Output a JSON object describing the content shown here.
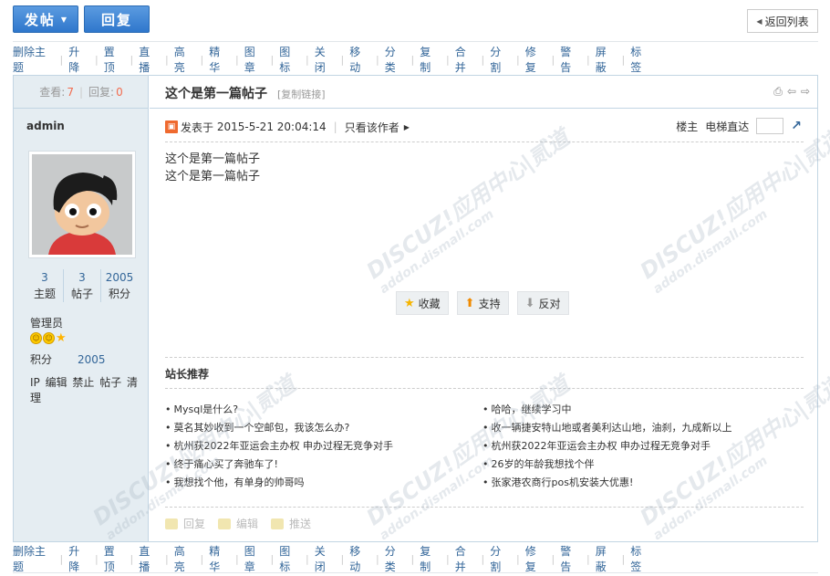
{
  "toolbar": {
    "post_label": "发帖",
    "reply_label": "回复",
    "back_label": "返回列表"
  },
  "mod_links": [
    "删除主题",
    "升降",
    "置顶",
    "直播",
    "高亮",
    "精华",
    "图章",
    "图标",
    "关闭",
    "移动",
    "分类",
    "复制",
    "合并",
    "分割",
    "修复",
    "警告",
    "屏蔽",
    "标签"
  ],
  "thread_stats": {
    "views_label": "查看:",
    "views": "7",
    "replies_label": "回复:",
    "replies": "0"
  },
  "thread": {
    "title": "这个是第一篇帖子",
    "copy_link": "[复制链接]"
  },
  "author": {
    "name": "admin",
    "stats": [
      {
        "value": "3",
        "label": "主题"
      },
      {
        "value": "3",
        "label": "帖子"
      },
      {
        "value": "2005",
        "label": "积分"
      }
    ],
    "group": "管理员",
    "credits_label": "积分",
    "credits_value": "2005",
    "tools": "IP 编辑 禁止 帖子 清理"
  },
  "post": {
    "posted_prefix": "发表于",
    "posted_time": "2015-5-21 20:04:14",
    "only_author": "只看该作者",
    "floor_label": "楼主",
    "elevator_label": "电梯直达",
    "content_lines": [
      "这个是第一篇帖子",
      "这个是第一篇帖子"
    ]
  },
  "actions": {
    "favorite": "收藏",
    "support": "支持",
    "oppose": "反对"
  },
  "recommend": {
    "title": "站长推荐",
    "left": [
      "Mysql是什么?",
      "莫名其妙收到一个空邮包，我该怎么办?",
      "杭州获2022年亚运会主办权 申办过程无竞争对手",
      "终于痛心买了奔驰车了!",
      "我想找个他，有单身的帅哥吗"
    ],
    "right": [
      "哈哈，继续学习中",
      "收一辆捷安特山地或者美利达山地，油刹，九成新以上",
      "杭州获2022年亚运会主办权 申办过程无竞争对手",
      "26岁的年龄我想找个伴",
      "张家港农商行pos机安装大优惠!"
    ]
  },
  "footer_actions": {
    "reply": "回复",
    "edit": "编辑",
    "promote": "推送"
  },
  "watermark": {
    "brand": "DISCUZ!应用中心|贰道",
    "domain": "addon.dismall.com"
  }
}
